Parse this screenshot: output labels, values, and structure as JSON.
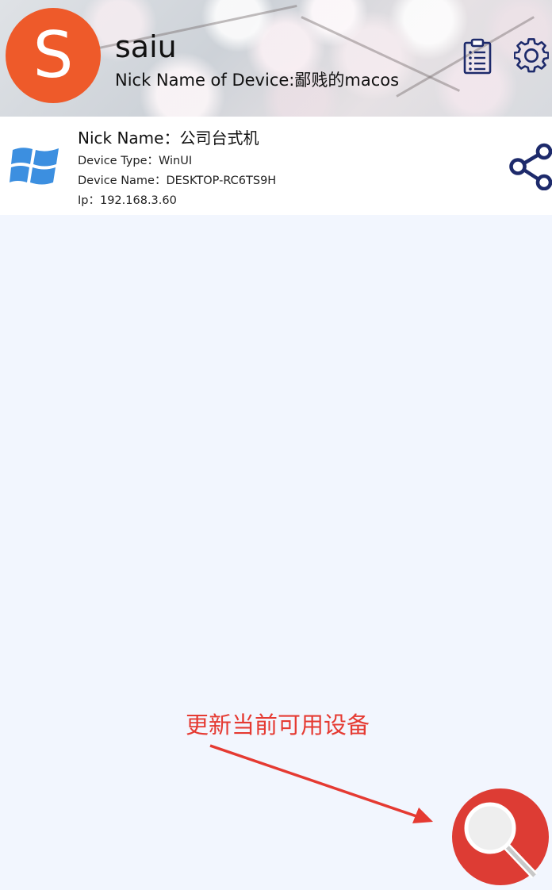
{
  "header": {
    "avatar_letter": "S",
    "username": "saiu",
    "device_nick_line": "Nick Name of Device:鄙贱的macos",
    "clipboard_icon": "clipboard-list-icon",
    "settings_icon": "gear-icon"
  },
  "device": {
    "os_icon": "windows-logo-icon",
    "nick_line": "Nick Name：公司台式机",
    "type_line": "Device Type：WinUI",
    "name_line": "Device Name：DESKTOP-RC6TS9H",
    "ip_line": "Ip：192.168.3.60",
    "share_icon": "share-icon"
  },
  "annotation": {
    "text": "更新当前可用设备"
  },
  "fab": {
    "icon": "search-icon"
  },
  "colors": {
    "avatar": "#ee5a2a",
    "icon_navy": "#1d2a6b",
    "windows_blue": "#3c8fe0",
    "background": "#f2f6fe",
    "annotation_red": "#e53a32",
    "fab_red": "#dd3c34"
  }
}
